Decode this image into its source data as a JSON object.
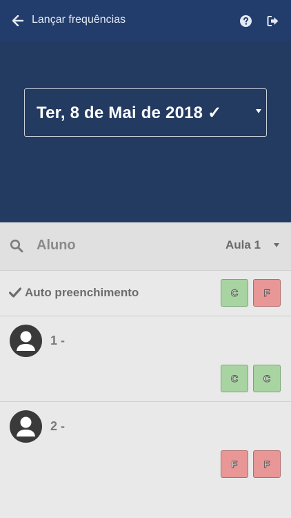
{
  "header": {
    "back_icon": "arrow-left-icon",
    "title": "Lançar frequências",
    "help_icon": "question-circle-icon",
    "exit_icon": "sign-out-icon"
  },
  "date_selector": {
    "value": "Ter, 8 de Mai de 2018 ✓"
  },
  "search": {
    "icon": "search-icon",
    "text": "Aluno",
    "class_select": "Aula 1"
  },
  "autofill": {
    "icon": "check-icon",
    "label": "Auto preenchimento",
    "buttons": [
      "C",
      "F"
    ]
  },
  "students": [
    {
      "label": "1 -",
      "marks": [
        "C",
        "C"
      ]
    },
    {
      "label": "2 -",
      "marks": [
        "F",
        "F"
      ]
    }
  ],
  "colors": {
    "header_bg": "#223d6c",
    "hero_bg": "#233a61",
    "present": "#a7d4a0",
    "absent": "#e89696"
  }
}
